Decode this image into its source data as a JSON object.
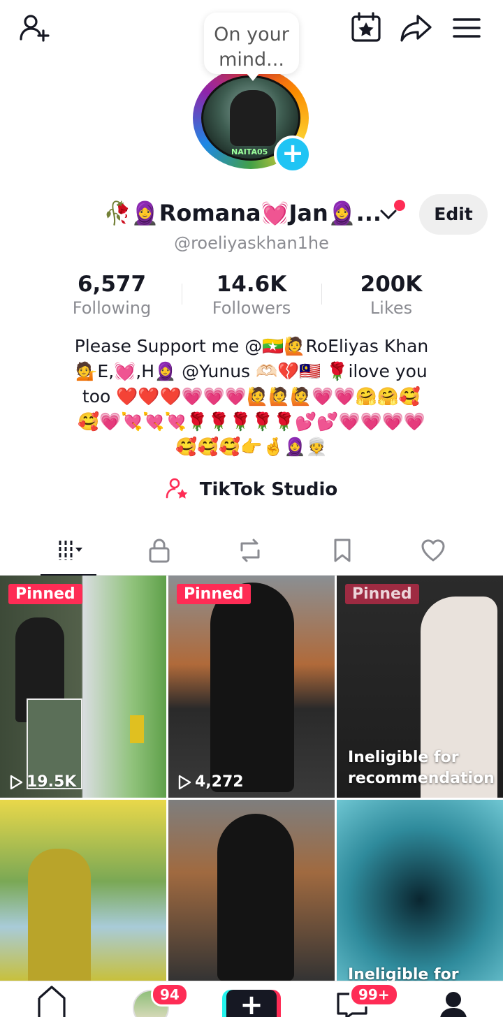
{
  "header": {
    "add_friend_icon": "person-add-icon",
    "calendar_icon": "calendar-star-icon",
    "share_icon": "share-arrow-icon",
    "menu_icon": "hamburger-menu-icon",
    "bubble_text": "On your mind..."
  },
  "profile": {
    "display_name": "🥀🧕Romana💓Jan🧕...",
    "handle": "@roeliyaskhan1he",
    "edit_label": "Edit",
    "stats": [
      {
        "value": "6,577",
        "label": "Following"
      },
      {
        "value": "14.6K",
        "label": "Followers"
      },
      {
        "value": "200K",
        "label": "Likes"
      }
    ],
    "bio_lines": [
      "Please Support me @🇲🇲🙋RoEliyas Khan",
      "💁E,💓,H🧕 @Yunus 🫶🏻💔🇲🇾 🌹ilove you",
      "too ❤️❤️❤️💗💗💗🙋🙋🙋💗💗🤗🤗🥰",
      "🥰💗💘💘💘🌹🌹🌹🌹🌹💕💕💗💗💗💗",
      "🥰🥰🥰👉🤞🧕👳"
    ],
    "studio_label": "TikTok Studio"
  },
  "tabs": [
    "videos",
    "private",
    "reposts",
    "favorites",
    "liked"
  ],
  "videos": [
    {
      "badge": "Pinned",
      "views": "19.5K"
    },
    {
      "badge": "Pinned",
      "views": "4,272"
    },
    {
      "badge": "Pinned",
      "note": "Ineligible for recommendation"
    },
    {},
    {},
    {
      "note": "Ineligible for"
    }
  ],
  "bottom_nav": {
    "friends_badge": "94",
    "inbox_badge": "99+"
  },
  "colors": {
    "accent": "#fe2c55",
    "avatar_plus": "#20c4f4",
    "muted_text": "#8a8b91"
  }
}
